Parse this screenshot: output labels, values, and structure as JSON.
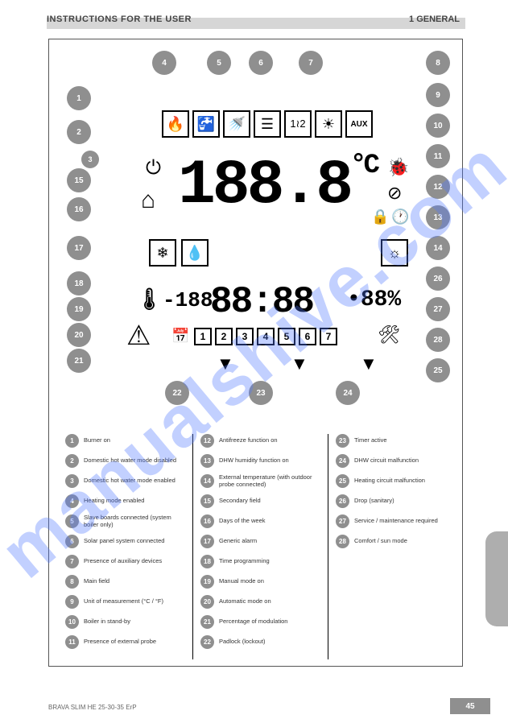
{
  "header": {
    "chapter": "INSTRUCTIONS FOR THE USER",
    "section": "1 GENERAL"
  },
  "diagram": {
    "bubbles_top": [
      "4",
      "5",
      "6",
      "7",
      "8"
    ],
    "bubbles_left": [
      "1",
      "2",
      "3",
      "15",
      "16",
      "17",
      "18",
      "19",
      "20",
      "21"
    ],
    "bubbles_right": [
      "9",
      "10",
      "11",
      "12",
      "13",
      "14",
      "26",
      "27",
      "28",
      "25"
    ],
    "bubbles_bottom": [
      "22",
      "23",
      "24"
    ],
    "lcd": {
      "main_value": "188.8",
      "main_unit": "°C",
      "time_value": "88:88",
      "temp_small": "-188",
      "humidity": "88",
      "humidity_unit": "%",
      "days": [
        "1",
        "2",
        "3",
        "4",
        "5",
        "6",
        "7"
      ],
      "icons_row1": [
        "flame",
        "tap-off",
        "tap-on",
        "radiator",
        "cascade",
        "solar",
        "aux"
      ],
      "icons_misc": [
        "power",
        "house",
        "snowflake",
        "drop",
        "sun",
        "bug",
        "no-bug",
        "lock",
        "clock",
        "thermometer",
        "calendar",
        "warning",
        "tools",
        "triangle-down",
        "triangle-down",
        "triangle-down"
      ]
    }
  },
  "legend": {
    "col1": [
      {
        "n": "1",
        "t": "Burner on"
      },
      {
        "n": "2",
        "t": "Domestic hot water mode disabled"
      },
      {
        "n": "3",
        "t": "Domestic hot water mode enabled"
      },
      {
        "n": "4",
        "t": "Heating mode enabled"
      },
      {
        "n": "5",
        "t": "Slave boards connected (system boiler only)"
      },
      {
        "n": "6",
        "t": "Solar panel system connected"
      },
      {
        "n": "7",
        "t": "Presence of auxiliary devices"
      },
      {
        "n": "8",
        "t": "Main field"
      },
      {
        "n": "9",
        "t": "Unit of measurement (°C / °F)"
      },
      {
        "n": "10",
        "t": "Boiler in stand-by"
      },
      {
        "n": "11",
        "t": "Presence of external probe"
      }
    ],
    "col2": [
      {
        "n": "12",
        "t": "Antifreeze function on"
      },
      {
        "n": "13",
        "t": "DHW humidity function on"
      },
      {
        "n": "14",
        "t": "External temperature (with outdoor probe connected)"
      },
      {
        "n": "15",
        "t": "Secondary field"
      },
      {
        "n": "16",
        "t": "Days of the week"
      },
      {
        "n": "17",
        "t": "Generic alarm"
      },
      {
        "n": "18",
        "t": "Time programming"
      },
      {
        "n": "19",
        "t": "Manual mode on"
      },
      {
        "n": "20",
        "t": "Automatic mode on"
      },
      {
        "n": "21",
        "t": "Percentage of modulation"
      },
      {
        "n": "22",
        "t": "Padlock (lockout)"
      }
    ],
    "col3": [
      {
        "n": "23",
        "t": "Timer active"
      },
      {
        "n": "24",
        "t": "DHW circuit malfunction"
      },
      {
        "n": "25",
        "t": "Heating circuit malfunction"
      },
      {
        "n": "26",
        "t": "Drop (sanitary)"
      },
      {
        "n": "27",
        "t": "Service / maintenance required"
      },
      {
        "n": "28",
        "t": "Comfort / sun mode"
      }
    ]
  },
  "footer": {
    "model": "BRAVA SLIM HE 25-30-35 ErP",
    "page": "45"
  },
  "watermark": "manualshive.com"
}
